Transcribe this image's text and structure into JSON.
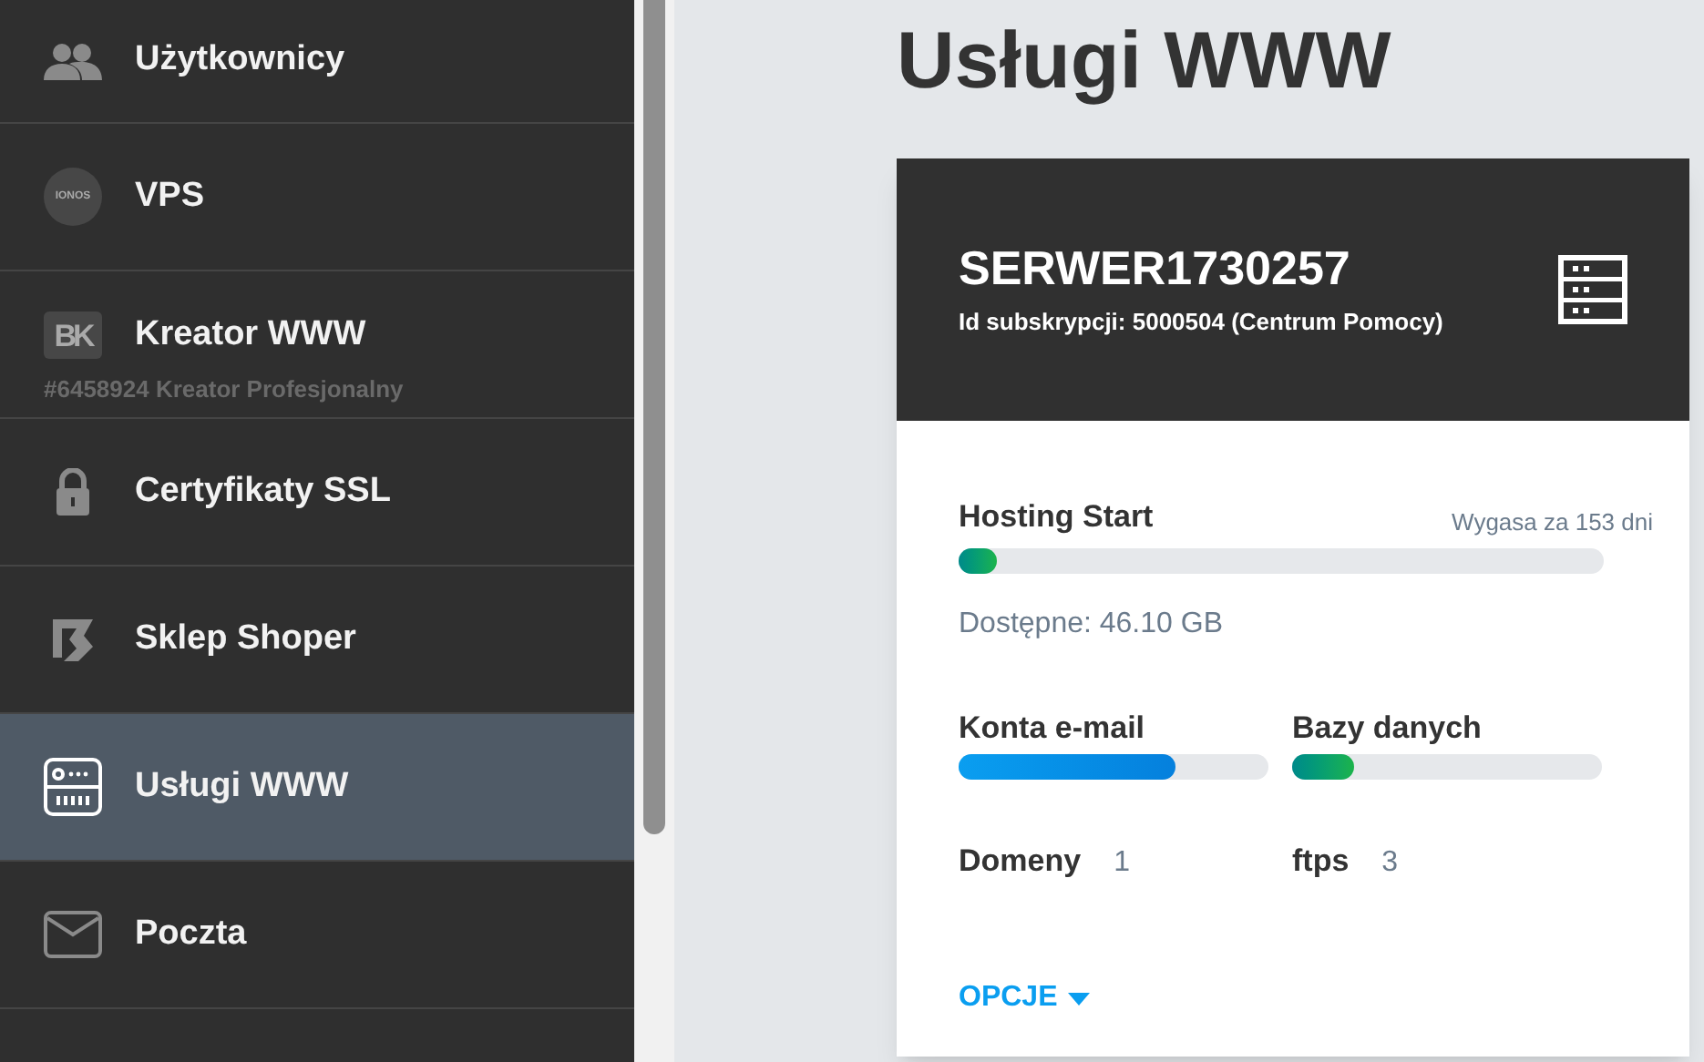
{
  "sidebar": {
    "items": [
      {
        "kind": "users",
        "label": "Użytkownicy",
        "selected": false
      },
      {
        "kind": "vps",
        "label": "VPS",
        "icon_text": "IONOS",
        "selected": false
      },
      {
        "kind": "builder",
        "label": "Kreator WWW",
        "icon_text": "BK",
        "sublabel": "#6458924 Kreator Profesjonalny",
        "selected": false
      },
      {
        "kind": "lock",
        "label": "Certyfikaty SSL",
        "selected": false
      },
      {
        "kind": "shop",
        "label": "Sklep Shoper",
        "selected": false
      },
      {
        "kind": "server",
        "label": "Usługi WWW",
        "selected": true
      },
      {
        "kind": "mail",
        "label": "Poczta",
        "selected": false
      },
      {
        "kind": "partial",
        "selected": false
      }
    ]
  },
  "page_title": "Usługi WWW",
  "card": {
    "name": "SERWER1730257",
    "subscription": "Id subskrypcji: 5000504 (Centrum Pomocy)",
    "plan": {
      "label": "Hosting Start",
      "expiry": "Wygasa za 153 dni",
      "level": 0.06,
      "available": "Dostępne: 46.10 GB"
    },
    "meters": [
      {
        "label": "Konta e-mail",
        "kind": "blue",
        "level": 0.7
      },
      {
        "label": "Bazy danych",
        "kind": "green",
        "level": 0.2
      }
    ],
    "counts": [
      {
        "label": "Domeny",
        "value": "1"
      },
      {
        "label": "ftps",
        "value": "3"
      }
    ],
    "options": "OPCJE"
  }
}
